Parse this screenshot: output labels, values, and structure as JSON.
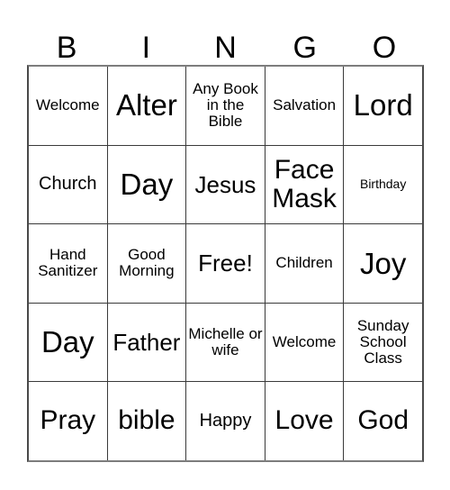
{
  "card": {
    "header_letters": [
      "B",
      "I",
      "N",
      "G",
      "O"
    ],
    "background_color": "#ffffff",
    "text_color": "#000000",
    "border_color": "#3a3a3a",
    "rows": [
      [
        {
          "text": "Welcome",
          "size": "sz-xs"
        },
        {
          "text": "Alter",
          "size": "sz-xl"
        },
        {
          "text": "Any Book in the Bible",
          "size": "sz-xs"
        },
        {
          "text": "Salvation",
          "size": "sz-xs"
        },
        {
          "text": "Lord",
          "size": "sz-xl"
        }
      ],
      [
        {
          "text": "Church",
          "size": "sz-sm"
        },
        {
          "text": "Day",
          "size": "sz-xl"
        },
        {
          "text": "Jesus",
          "size": "sz-md"
        },
        {
          "text": "Face Mask",
          "size": "sz-lg"
        },
        {
          "text": "Birthday",
          "size": "sz-xxs"
        }
      ],
      [
        {
          "text": "Hand Sanitizer",
          "size": "sz-xs"
        },
        {
          "text": "Good Morning",
          "size": "sz-xs"
        },
        {
          "text": "Free!",
          "size": "sz-md"
        },
        {
          "text": "Children",
          "size": "sz-xs"
        },
        {
          "text": "Joy",
          "size": "sz-xl"
        }
      ],
      [
        {
          "text": "Day",
          "size": "sz-xl"
        },
        {
          "text": "Father",
          "size": "sz-md"
        },
        {
          "text": "Michelle or wife",
          "size": "sz-xs"
        },
        {
          "text": "Welcome",
          "size": "sz-xs"
        },
        {
          "text": "Sunday School Class",
          "size": "sz-xs"
        }
      ],
      [
        {
          "text": "Pray",
          "size": "sz-lg"
        },
        {
          "text": "bible",
          "size": "sz-lg"
        },
        {
          "text": "Happy",
          "size": "sz-sm"
        },
        {
          "text": "Love",
          "size": "sz-lg"
        },
        {
          "text": "God",
          "size": "sz-lg"
        }
      ]
    ]
  }
}
